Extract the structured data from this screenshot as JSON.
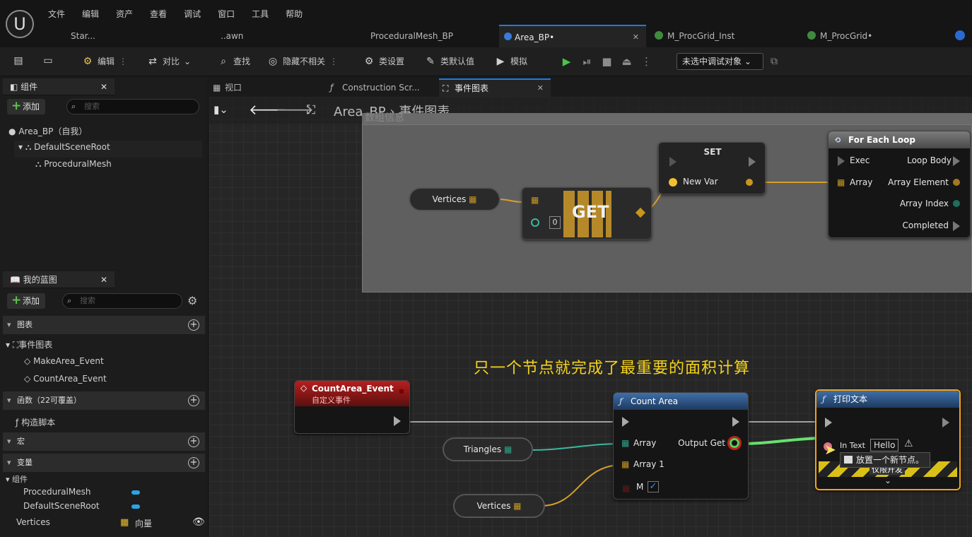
{
  "menu": [
    "文件",
    "编辑",
    "资产",
    "查看",
    "调试",
    "窗口",
    "工具",
    "帮助"
  ],
  "tabs": [
    {
      "label": "Star..."
    },
    {
      "label": "..awn"
    },
    {
      "label": "ProceduralMesh_BP"
    },
    {
      "label": "Area_BP•",
      "active": true
    },
    {
      "label": "M_ProcGrid_Inst"
    },
    {
      "label": "M_ProcGrid•"
    }
  ],
  "toolbar": {
    "compile": "编辑",
    "diff": "对比",
    "find": "查找",
    "hide": "隐藏不相关",
    "class_settings": "类设置",
    "class_defaults": "类默认值",
    "simulate": "模拟",
    "debug_target": "未选中调试对象"
  },
  "components": {
    "title": "组件",
    "add": "添加",
    "search_placeholder": "搜索",
    "root": "Area_BP（自我）",
    "scene_root": "DefaultSceneRoot",
    "mesh": "ProceduralMesh"
  },
  "my_blueprint": {
    "title": "我的蓝图",
    "add": "添加",
    "search_placeholder": "搜索",
    "graphs_section": "图表",
    "event_graph": "事件图表",
    "events": [
      "MakeArea_Event",
      "CountArea_Event"
    ],
    "functions_section": "函数（22可覆盖）",
    "construction_script": "构造脚本",
    "macros_section": "宏",
    "variables_section": "变量",
    "components_group": "组件",
    "vars": [
      {
        "name": "ProceduralMesh"
      },
      {
        "name": "DefaultSceneRoot"
      }
    ],
    "vertices_var": "Vertices",
    "vertices_type": "向量"
  },
  "editor_tabs": {
    "viewport": "视口",
    "construction": "Construction Scr...",
    "event_graph": "事件图表"
  },
  "breadcrumb": {
    "blueprint": "Area_BP",
    "graph": "事件图表"
  },
  "comment_title": "数组信息",
  "nodes": {
    "vertices": "Vertices",
    "get": "GET",
    "get_index": "0",
    "set_title": "SET",
    "set_pin": "New Var",
    "for_each": {
      "title": "For Each Loop",
      "exec": "Exec",
      "loop_body": "Loop Body",
      "array": "Array",
      "element": "Array Element",
      "index": "Array Index",
      "completed": "Completed"
    },
    "event": {
      "title": "CountArea_Event",
      "subtitle": "自定义事件"
    },
    "triangles": "Triangles",
    "vertices2": "Vertices",
    "count_area": {
      "title": "Count Area",
      "array": "Array",
      "array1": "Array 1",
      "m": "M",
      "output": "Output Get"
    },
    "print": {
      "title": "打印文本",
      "in_text": "In Text",
      "hello": "Hello",
      "dev_only": "仅限开发"
    }
  },
  "tooltip": "放置一个新节点。",
  "subtitle": "只一个节点就完成了最重要的面积计算",
  "colors": {
    "accent": "#1e7ce0",
    "exec_wire": "#c8c8c8",
    "green_wire": "#66e06e",
    "subtitle": "#f4d21a",
    "event_red": "#a21c1c"
  }
}
